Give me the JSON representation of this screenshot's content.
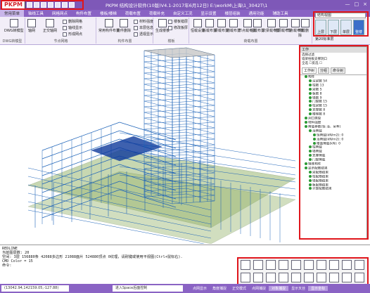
{
  "app": {
    "logo": "PKPM",
    "title": "PKPM 结构设计软件(10版)V4.1-2017年6月12日) E:\\workM\\上海\\1_3042T\\1"
  },
  "window_controls": [
    "—",
    "□",
    "×"
  ],
  "menu": [
    "常用菜单",
    "轴线工具",
    "网格网点",
    "构件布置",
    "楼板/楼梯",
    "荷载布置",
    "荷载补充",
    "自定义工况",
    "显示设置",
    "楼层组装",
    "通用功能",
    "辅助工具"
  ],
  "ribbon": {
    "groups": [
      {
        "label": "DWG转模型",
        "buttons": [
          "DWG转模型"
        ]
      },
      {
        "label": "节点网格",
        "buttons": [
          "轴网",
          "正交轴网"
        ]
      },
      {
        "label": "构件布置",
        "buttons": [
          "常用构件布置",
          "构件删除",
          "构件修改"
        ]
      },
      {
        "label": "楼板",
        "buttons": [
          "生成楼板",
          "楼板错层",
          "修改板厚"
        ]
      },
      {
        "label": "荷载布置",
        "buttons": [
          "恒载设置",
          "板载布置",
          "梁载布置",
          "墙载布置",
          "节点载布置",
          "柱载布置",
          "次梁载布置",
          "墙洞载布置",
          "节点载布置",
          "荷载删除"
        ]
      }
    ],
    "small_items": [
      "删除网格",
      "轴线显示",
      "形成网点",
      "楼板布置",
      "材料强度",
      "本层信息",
      "构件查询",
      "透视显示"
    ]
  },
  "viewcube": {
    "select": "结构视图",
    "buttons": [
      "上层",
      "下层",
      "单层",
      "整楼"
    ],
    "active": "整楼",
    "sub": "第20标准层"
  },
  "panel": {
    "title": "工作",
    "filter": [
      "选择过滤",
      "墙梁柱板支撑洞口",
      "全选 ☐反选 ☐"
    ],
    "tabs": [
      "工作树",
      "分组",
      "命令树"
    ],
    "tree": [
      "构件",
      "深梁数 54",
      "柱数 13",
      "梁数 5",
      "板数 8",
      "墙数 9",
      "门窗数 15",
      "柱梁数 15",
      "支撑数 8",
      "楼梯数 8",
      "洞口类型",
      "材料强度",
      "荷载参数(恒 活、吊车)",
      "活荷载",
      "恒荷载(kN/m2): 0",
      "活荷载(kN/m2): 0",
      "楼面荷载(kN): 0",
      "柱荷载",
      "墙荷载",
      "支座荷载",
      "门窗荷载",
      "特殊构件",
      "显示配筋结果",
      "梁配筋结果",
      "柱配筋结果",
      "墙配筋结果",
      "板配筋结果",
      "计算配筋结果"
    ]
  },
  "command": {
    "lines": [
      "REDLINE",
      "当前图层数: 20",
      "空间: 3层  156880条  42088多边形  21088面片  524880顶点  0纹理，请耐键或使用平视图(Ctrl+鼠标右).",
      "CMD Color = 15",
      "命令:"
    ]
  },
  "status": {
    "coords": "(13042.94,142159.05,-127.88)",
    "prompt": "进入Space后面控制",
    "buttons": [
      "点网显示",
      "角度捕捉",
      "正交模式",
      "点网捕捉",
      "对象捕捉",
      "显示叉丝",
      "显示坐标"
    ],
    "active": [
      "对象捕捉",
      "显示坐标"
    ]
  },
  "colors": {
    "title_bar": "#7e58b8",
    "menu_bar": "#8a63c4",
    "highlight_box": "#e0161c",
    "structure_blue": "#1d63b8",
    "slab_green": "#9bb873",
    "tree_dot": "#2c9a35"
  }
}
